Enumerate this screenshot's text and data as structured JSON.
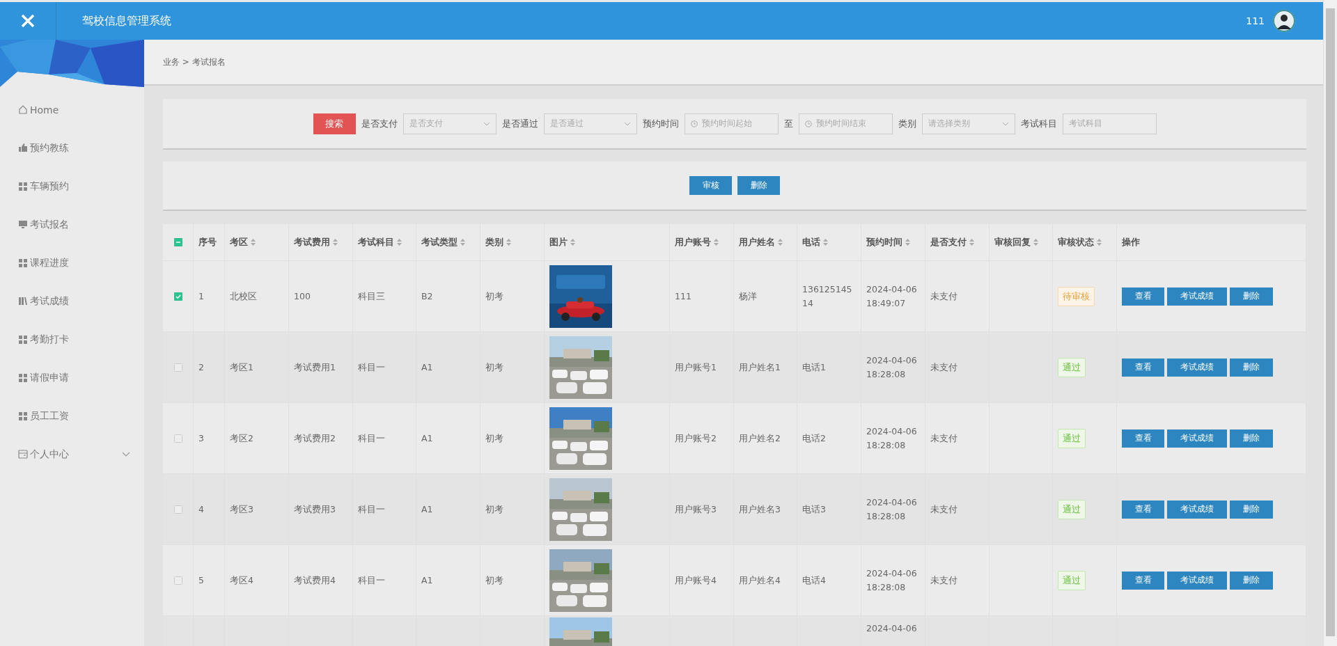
{
  "header": {
    "title": "驾校信息管理系统",
    "user": "111"
  },
  "breadcrumb": "业务 > 考试报名",
  "sidebar": {
    "items": [
      {
        "label": "Home"
      },
      {
        "label": "预约教练"
      },
      {
        "label": "车辆预约"
      },
      {
        "label": "考试报名"
      },
      {
        "label": "课程进度"
      },
      {
        "label": "考试成绩"
      },
      {
        "label": "考勤打卡"
      },
      {
        "label": "请假申请"
      },
      {
        "label": "员工工资"
      },
      {
        "label": "个人中心",
        "expanded": false
      }
    ]
  },
  "search": {
    "button": "搜索",
    "fields": [
      {
        "label": "是否支付",
        "kind": "select",
        "placeholder": "是否支付"
      },
      {
        "label": "是否通过",
        "kind": "select",
        "placeholder": "是否通过"
      },
      {
        "label": "预约时间",
        "kind": "date",
        "placeholder": "预约时间起始"
      },
      {
        "label": "至",
        "kind": "date",
        "placeholder": "预约时间结束"
      },
      {
        "label": "类别",
        "kind": "select",
        "placeholder": "请选择类别"
      },
      {
        "label": "考试科目",
        "kind": "text",
        "placeholder": "考试科目"
      }
    ]
  },
  "actions": [
    "审核",
    "删除"
  ],
  "table": {
    "select_all_checked": true,
    "select_all_partial": true,
    "columns": [
      {
        "label": "序号",
        "sortable": false
      },
      {
        "label": "考区",
        "sortable": true
      },
      {
        "label": "考试费用",
        "sortable": true
      },
      {
        "label": "考试科目",
        "sortable": true
      },
      {
        "label": "考试类型",
        "sortable": true
      },
      {
        "label": "类别",
        "sortable": true
      },
      {
        "label": "图片",
        "sortable": true
      },
      {
        "label": "用户账号",
        "sortable": true
      },
      {
        "label": "用户姓名",
        "sortable": true
      },
      {
        "label": "电话",
        "sortable": true
      },
      {
        "label": "预约时间",
        "sortable": true
      },
      {
        "label": "是否支付",
        "sortable": true
      },
      {
        "label": "审核回复",
        "sortable": true
      },
      {
        "label": "审核状态",
        "sortable": true
      },
      {
        "label": "操作",
        "sortable": false
      }
    ],
    "rows": [
      {
        "kind": "full",
        "selected": true,
        "cells": [
          "1",
          "北校区",
          "100",
          "科目三",
          "B2",
          "初考"
        ],
        "picture": {
          "kind": "picture"
        },
        "cells2": [
          "111",
          "杨洋",
          "13612514514",
          "2024-04-06 18:49:07",
          "未支付"
        ],
        "status": {
          "text": "待审核",
          "kind": "pending"
        },
        "buttons": [
          "查看",
          "考试成绩",
          "删除"
        ]
      },
      {
        "kind": "full",
        "selected": false,
        "cells": [
          "2",
          "考区1",
          "考试费用1",
          "科目一",
          "A1",
          "初考"
        ],
        "picture": {
          "kind": "picture"
        },
        "cells2": [
          "用户账号1",
          "用户姓名1",
          "电话1",
          "2024-04-06 18:28:08",
          "未支付"
        ],
        "status": {
          "text": "通过",
          "kind": "approved"
        },
        "buttons": [
          "查看",
          "考试成绩",
          "删除"
        ]
      },
      {
        "kind": "full",
        "selected": false,
        "cells": [
          "3",
          "考区2",
          "考试费用2",
          "科目一",
          "A1",
          "初考"
        ],
        "picture": {
          "kind": "picture"
        },
        "cells2": [
          "用户账号2",
          "用户姓名2",
          "电话2",
          "2024-04-06 18:28:08",
          "未支付"
        ],
        "status": {
          "text": "通过",
          "kind": "approved"
        },
        "buttons": [
          "查看",
          "考试成绩",
          "删除"
        ]
      },
      {
        "kind": "full",
        "selected": false,
        "cells": [
          "4",
          "考区3",
          "考试费用3",
          "科目一",
          "A1",
          "初考"
        ],
        "picture": {
          "kind": "picture"
        },
        "cells2": [
          "用户账号3",
          "用户姓名3",
          "电话3",
          "2024-04-06 18:28:08",
          "未支付"
        ],
        "status": {
          "text": "通过",
          "kind": "approved"
        },
        "buttons": [
          "查看",
          "考试成绩",
          "删除"
        ]
      },
      {
        "kind": "full",
        "selected": false,
        "cells": [
          "5",
          "考区4",
          "考试费用4",
          "科目一",
          "A1",
          "初考"
        ],
        "picture": {
          "kind": "picture"
        },
        "cells2": [
          "用户账号4",
          "用户姓名4",
          "电话4",
          "2024-04-06 18:28:08",
          "未支付"
        ],
        "status": {
          "text": "通过",
          "kind": "approved"
        },
        "buttons": [
          "查看",
          "考试成绩",
          "删除"
        ]
      },
      {
        "kind": "partial",
        "picture": {
          "kind": "picture"
        },
        "date": "2024-04-06"
      }
    ]
  }
}
